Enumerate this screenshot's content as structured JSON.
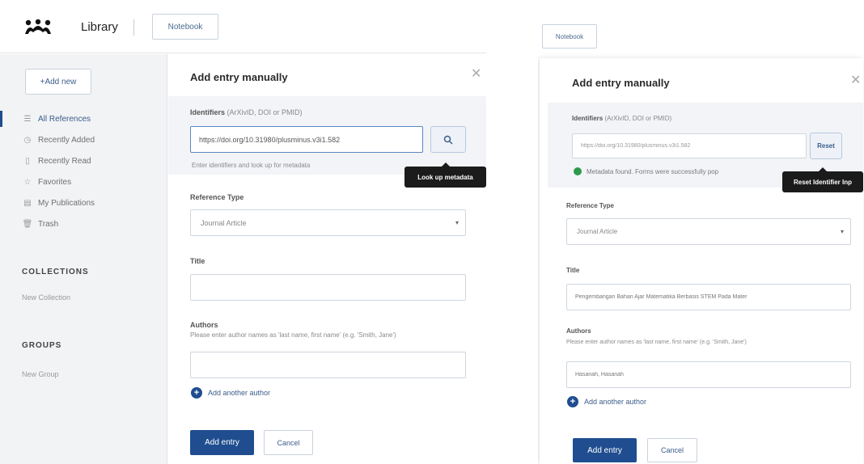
{
  "app": {
    "title": "Library",
    "notebook_label": "Notebook"
  },
  "sidebar": {
    "add_new_label": "+Add new",
    "nav": [
      {
        "icon": "list-icon",
        "glyph": "☰",
        "label": "All References",
        "active": true
      },
      {
        "icon": "clock-icon",
        "glyph": "◷",
        "label": "Recently Added"
      },
      {
        "icon": "bookmark-icon",
        "glyph": "▯",
        "label": "Recently Read"
      },
      {
        "icon": "star-icon",
        "glyph": "☆",
        "label": "Favorites"
      },
      {
        "icon": "publications-icon",
        "glyph": "▤",
        "label": "My Publications"
      },
      {
        "icon": "trash-icon",
        "glyph": "🗑",
        "label": "Trash"
      }
    ],
    "collections_title": "COLLECTIONS",
    "new_collection": "New Collection",
    "groups_title": "GROUPS",
    "new_group": "New Group"
  },
  "dialog_left": {
    "title": "Add entry manually",
    "identifiers_label": "Identifiers",
    "identifiers_hint": "(ArXivID, DOI or PMID)",
    "identifier_value": "https://doi.org/10.31980/plusminus.v3i1.582",
    "lookup_help": "Enter identifiers and look up for metadata",
    "lookup_tooltip": "Look up metadata",
    "reference_type_label": "Reference Type",
    "reference_type_value": "Journal Article",
    "title_label": "Title",
    "title_value": "",
    "authors_label": "Authors",
    "authors_help": "Please enter author names as 'last name, first name' (e.g. 'Smith, Jane')",
    "author_value": "",
    "add_author_label": "Add another author",
    "add_entry_label": "Add entry",
    "cancel_label": "Cancel"
  },
  "dialog_right": {
    "notebook_label": "Notebook",
    "title": "Add entry manually",
    "identifiers_label": "Identifiers",
    "identifiers_hint": "(ArXivID, DOI or PMID)",
    "identifier_value": "https://doi.org/10.31980/plusminus.v3i1.582",
    "reset_label": "Reset",
    "reset_tooltip": "Reset Identifier Inp",
    "status_text": "Metadata found. Forms were successfully pop",
    "reference_type_label": "Reference Type",
    "reference_type_value": "Journal Article",
    "title_label": "Title",
    "title_value": "Pengembangan Bahan Ajar Matematika Berbasis STEM Pada Mater",
    "authors_label": "Authors",
    "authors_help": "Please enter author names as 'last name, first name' (e.g. 'Smith, Jane')",
    "author_value": "Hasanah, Hasanah",
    "add_author_label": "Add another author",
    "add_entry_label": "Add entry",
    "cancel_label": "Cancel"
  },
  "colors": {
    "primary": "#1f4d8f",
    "success": "#2e9a4b",
    "tooltip_bg": "#1b1b1b"
  }
}
